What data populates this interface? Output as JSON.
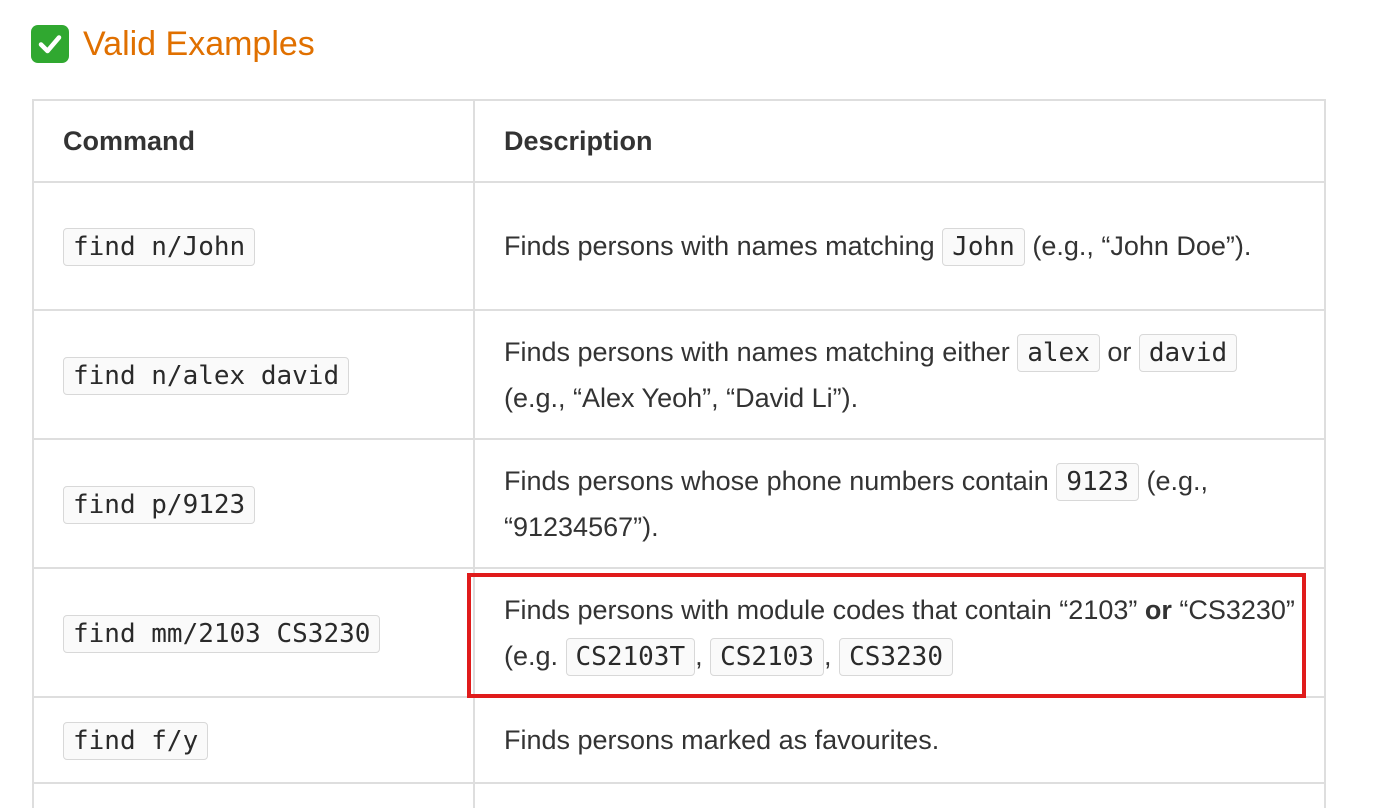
{
  "heading": {
    "icon": "check-mark-icon",
    "icon_color": "#30a830",
    "text": "Valid Examples",
    "text_color": "#e07000"
  },
  "table": {
    "headers": [
      "Command",
      "Description"
    ],
    "rows": [
      {
        "command": "find n/John",
        "desc": {
          "t1": "Finds persons with names matching ",
          "c1": "John",
          "t2": " (e.g., “John Doe”)."
        }
      },
      {
        "command": "find n/alex david",
        "desc": {
          "t1": "Finds persons with names matching either ",
          "c1": "alex",
          "t2": " or ",
          "c2": "david",
          "t3": " (e.g., “Alex Yeoh”, “David Li”)."
        }
      },
      {
        "command": "find p/9123",
        "desc": {
          "t1": "Finds persons whose phone numbers contain ",
          "c1": "9123",
          "t2": " (e.g., “91234567”)."
        }
      },
      {
        "command": "find mm/2103 CS3230",
        "desc": {
          "t1": "Finds persons with module codes that contain “2103” ",
          "b1": "or",
          "t2": " “CS3230” (e.g. ",
          "c1": "CS2103T",
          "s1": ", ",
          "c2": "CS2103",
          "s2": ", ",
          "c3": "CS3230"
        }
      },
      {
        "command": "find f/y",
        "desc": {
          "t1": "Finds persons marked as favourites."
        }
      }
    ]
  },
  "highlight_color": "#e01b1b"
}
